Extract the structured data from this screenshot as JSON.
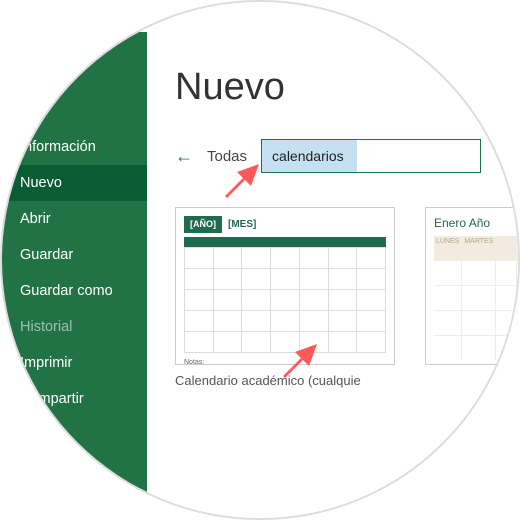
{
  "sidebar": {
    "items": [
      {
        "label": "Información"
      },
      {
        "label": "Nuevo"
      },
      {
        "label": "Abrir"
      },
      {
        "label": "Guardar"
      },
      {
        "label": "Guardar como"
      },
      {
        "label": "Historial"
      },
      {
        "label": "Imprimir"
      },
      {
        "label": "Compartir"
      }
    ]
  },
  "main": {
    "title": "Nuevo",
    "filter": "Todas",
    "search_value": "calendarios"
  },
  "templates": [
    {
      "year": "[AÑO]",
      "month": "[MES]",
      "notes": "Notas:",
      "caption": "Calendario académico (cualquie"
    },
    {
      "title": "Enero Año",
      "day1": "LUNES",
      "day2": "MARTES",
      "caption": ""
    }
  ]
}
